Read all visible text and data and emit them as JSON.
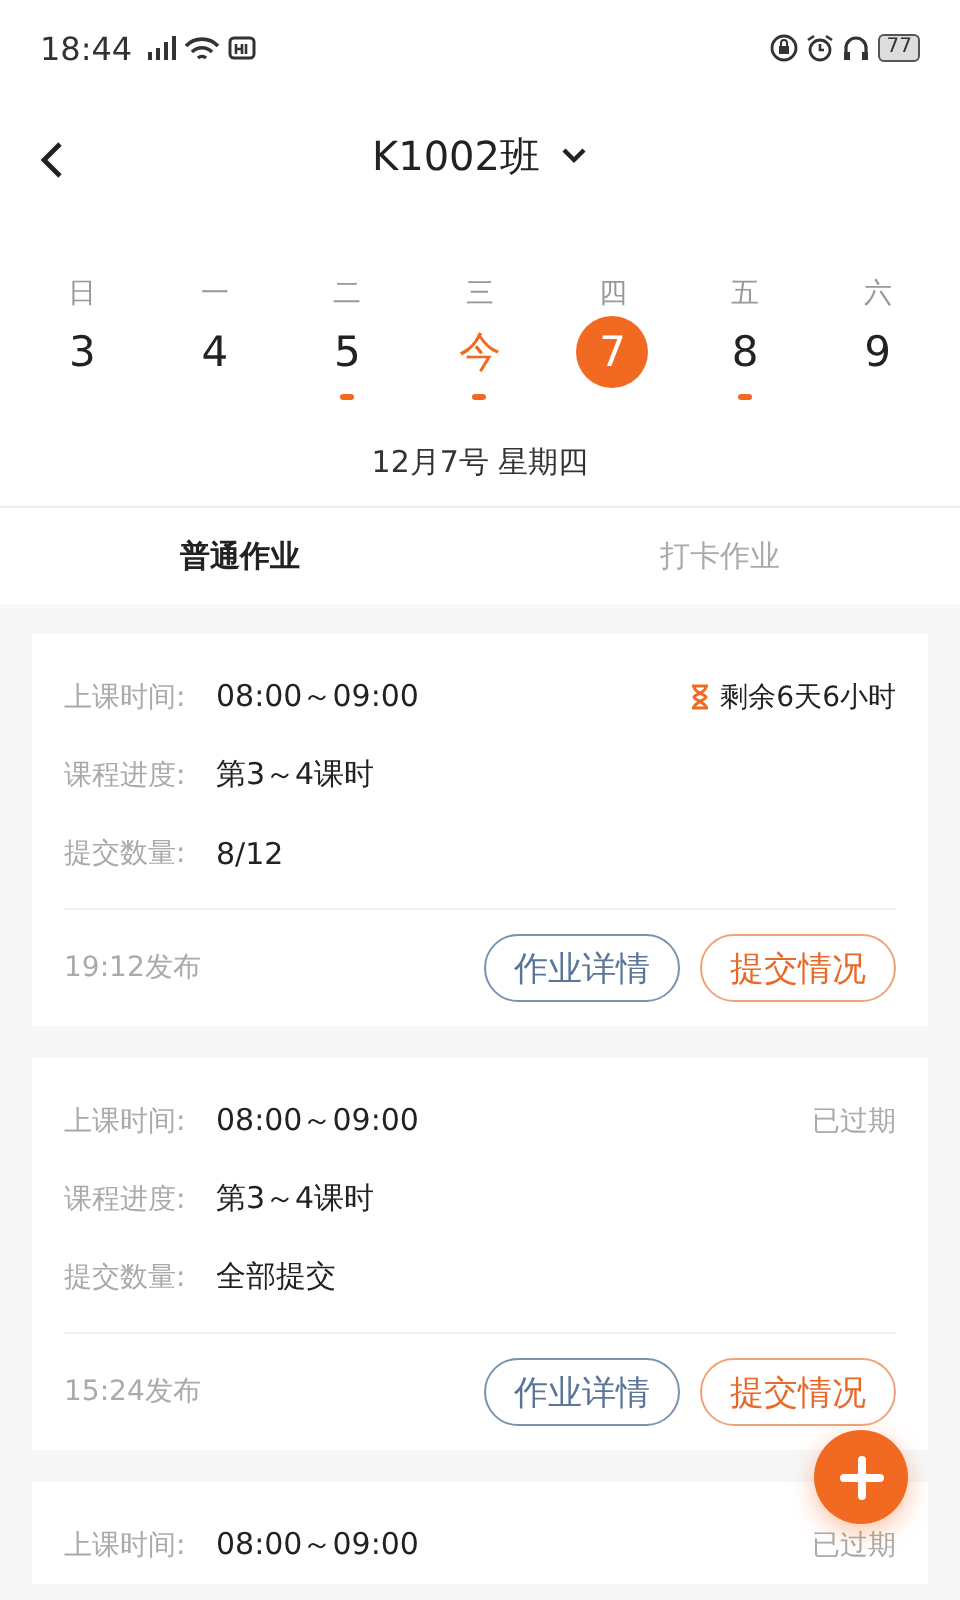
{
  "status_bar": {
    "time": "18:44",
    "battery": "77"
  },
  "header": {
    "title": "K1002班"
  },
  "week": [
    {
      "weekday": "日",
      "label": "3",
      "today": false,
      "selected": false,
      "has_task": false
    },
    {
      "weekday": "一",
      "label": "4",
      "today": false,
      "selected": false,
      "has_task": false
    },
    {
      "weekday": "二",
      "label": "5",
      "today": false,
      "selected": false,
      "has_task": true
    },
    {
      "weekday": "三",
      "label": "今",
      "today": true,
      "selected": false,
      "has_task": true
    },
    {
      "weekday": "四",
      "label": "7",
      "today": false,
      "selected": true,
      "has_task": false
    },
    {
      "weekday": "五",
      "label": "8",
      "today": false,
      "selected": false,
      "has_task": true
    },
    {
      "weekday": "六",
      "label": "9",
      "today": false,
      "selected": false,
      "has_task": false
    }
  ],
  "date_caption": "12月7号 星期四",
  "tabs": [
    {
      "label": "普通作业",
      "selected": true
    },
    {
      "label": "打卡作业",
      "selected": false
    }
  ],
  "cards": [
    {
      "status": {
        "kind": "remaining",
        "text": "剩余6天6小时"
      },
      "rows": [
        {
          "label": "上课时间:",
          "value": "08:00～09:00"
        },
        {
          "label": "课程进度:",
          "value": "第3～4课时"
        },
        {
          "label": "提交数量:",
          "value": "8/12"
        }
      ],
      "published": "19:12发布",
      "buttons": [
        "作业详情",
        "提交情况"
      ]
    },
    {
      "status": {
        "kind": "expired",
        "text": "已过期"
      },
      "rows": [
        {
          "label": "上课时间:",
          "value": "08:00～09:00"
        },
        {
          "label": "课程进度:",
          "value": "第3～4课时"
        },
        {
          "label": "提交数量:",
          "value": "全部提交"
        }
      ],
      "published": "15:24发布",
      "buttons": [
        "作业详情",
        "提交情况"
      ]
    },
    {
      "status": {
        "kind": "expired",
        "text": "已过期"
      },
      "rows": [
        {
          "label": "上课时间:",
          "value": "08:00～09:00"
        }
      ]
    }
  ]
}
